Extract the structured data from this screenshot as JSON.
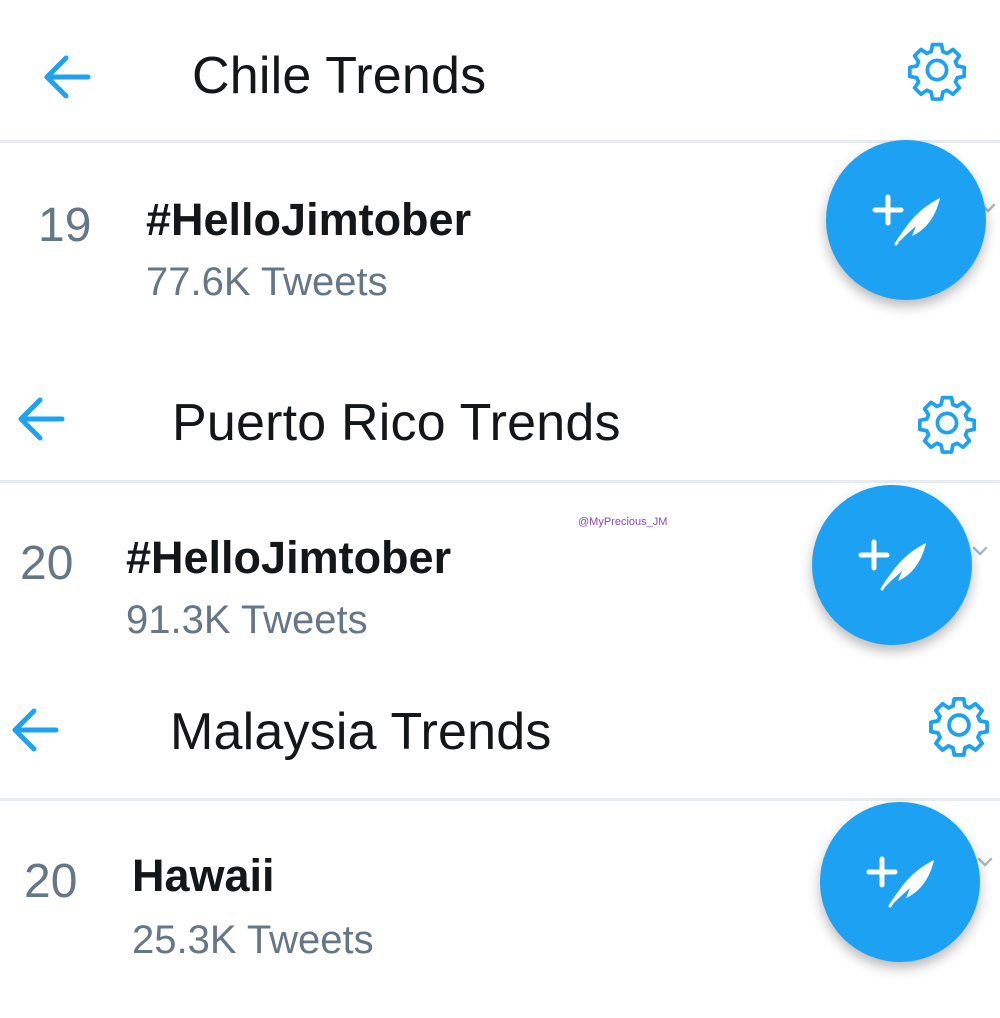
{
  "colors": {
    "accent": "#1da1f2",
    "text": "#14171a",
    "secondary": "#657786",
    "watermark": "#8a45c9"
  },
  "panels": [
    {
      "title": "Chile Trends",
      "rank": "19",
      "trend": "#HelloJimtober",
      "count": "77.6K",
      "count_label": "Tweets"
    },
    {
      "title": "Puerto Rico Trends",
      "rank": "20",
      "trend": "#HelloJimtober",
      "count": "91.3K",
      "count_label": "Tweets"
    },
    {
      "title": "Malaysia Trends",
      "rank": "20",
      "trend": "Hawaii",
      "count": "25.3K",
      "count_label": "Tweets"
    }
  ],
  "icons": {
    "back": "back-arrow-icon",
    "settings": "gear-icon",
    "compose": "compose-tweet-icon",
    "more": "chevron-down-icon"
  },
  "watermark": "@MyPrecious_JM"
}
